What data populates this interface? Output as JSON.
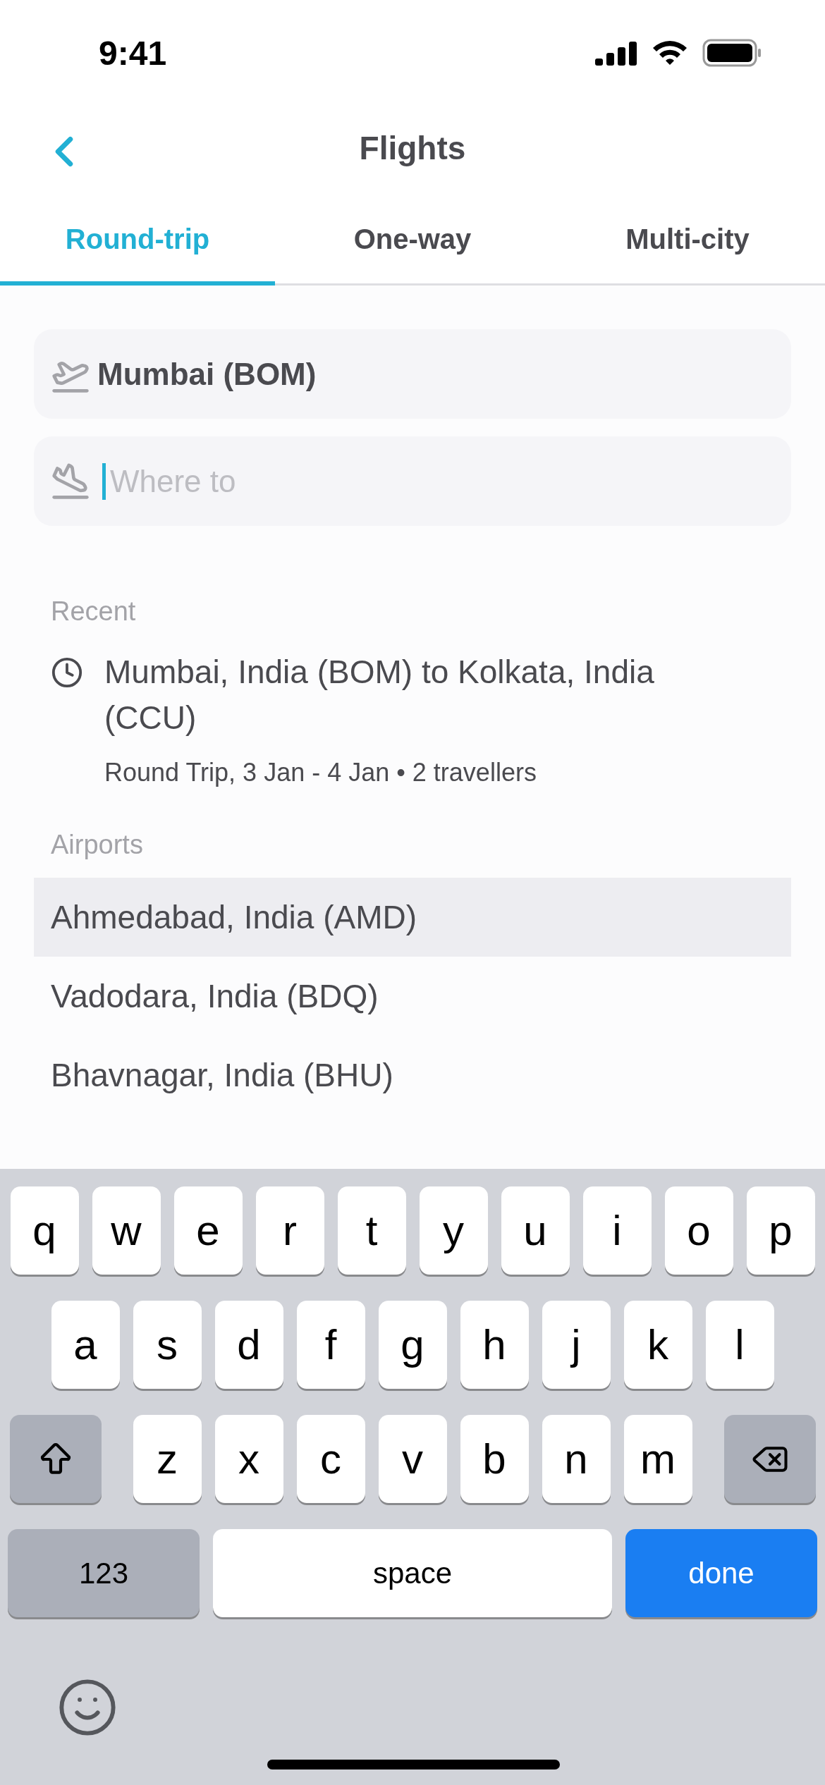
{
  "status_bar": {
    "time": "9:41"
  },
  "header": {
    "title": "Flights"
  },
  "tabs": [
    {
      "label": "Round-trip",
      "selected": true
    },
    {
      "label": "One-way",
      "selected": false
    },
    {
      "label": "Multi-city",
      "selected": false
    }
  ],
  "origin": {
    "value": "Mumbai (BOM)"
  },
  "destination": {
    "placeholder": "Where to",
    "focused": true
  },
  "recent": {
    "heading": "Recent",
    "items": [
      {
        "route": "Mumbai, India (BOM) to Kolkata, India (CCU)",
        "details": "Round Trip, 3 Jan - 4 Jan • 2 travellers"
      }
    ]
  },
  "airports": {
    "heading": "Airports",
    "items": [
      {
        "name": "Ahmedabad, India (AMD)",
        "highlighted": true
      },
      {
        "name": "Vadodara, India (BDQ)",
        "highlighted": false
      },
      {
        "name": "Bhavnagar, India (BHU)",
        "highlighted": false
      }
    ]
  },
  "keyboard": {
    "rows": [
      [
        "q",
        "w",
        "e",
        "r",
        "t",
        "y",
        "u",
        "i",
        "o",
        "p"
      ],
      [
        "a",
        "s",
        "d",
        "f",
        "g",
        "h",
        "j",
        "k",
        "l"
      ],
      [
        "z",
        "x",
        "c",
        "v",
        "b",
        "n",
        "m"
      ]
    ],
    "numbers_key": "123",
    "space_key": "space",
    "done_key": "done"
  }
}
